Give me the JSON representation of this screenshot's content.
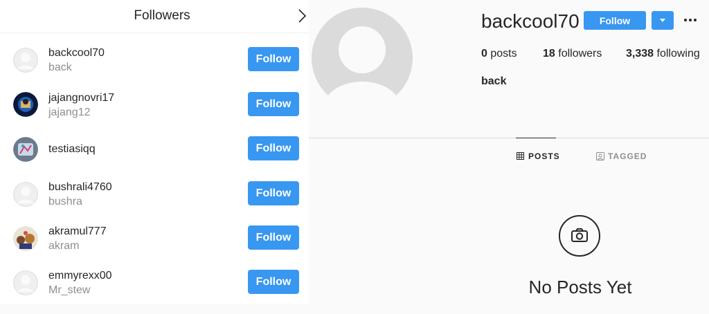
{
  "modal": {
    "title": "Followers",
    "follow_label": "Follow",
    "followers": [
      {
        "username": "backcool70",
        "name": "back",
        "avatar": "default-avatar"
      },
      {
        "username": "jajangnovri17",
        "name": "jajang12",
        "avatar": "photo-avatar"
      },
      {
        "username": "testiasiqq",
        "name": "",
        "avatar": "photo-avatar"
      },
      {
        "username": "bushrali4760",
        "name": "bushra",
        "avatar": "default-avatar"
      },
      {
        "username": "akramul777",
        "name": "akram",
        "avatar": "photo-avatar"
      },
      {
        "username": "emmyrexx00",
        "name": "Mr_stew",
        "avatar": "default-avatar"
      }
    ]
  },
  "profile": {
    "username": "backcool70",
    "follow_label": "Follow",
    "stats": {
      "posts_count": "0",
      "posts_label": "posts",
      "followers_count": "18",
      "followers_label": "followers",
      "following_count": "3,338",
      "following_label": "following"
    },
    "bio": "back",
    "tabs": {
      "posts": "POSTS",
      "tagged": "TAGGED"
    },
    "empty_state": "No Posts Yet"
  },
  "colors": {
    "accent": "#3897f0",
    "muted": "#8e8e8e",
    "text": "#262626"
  }
}
